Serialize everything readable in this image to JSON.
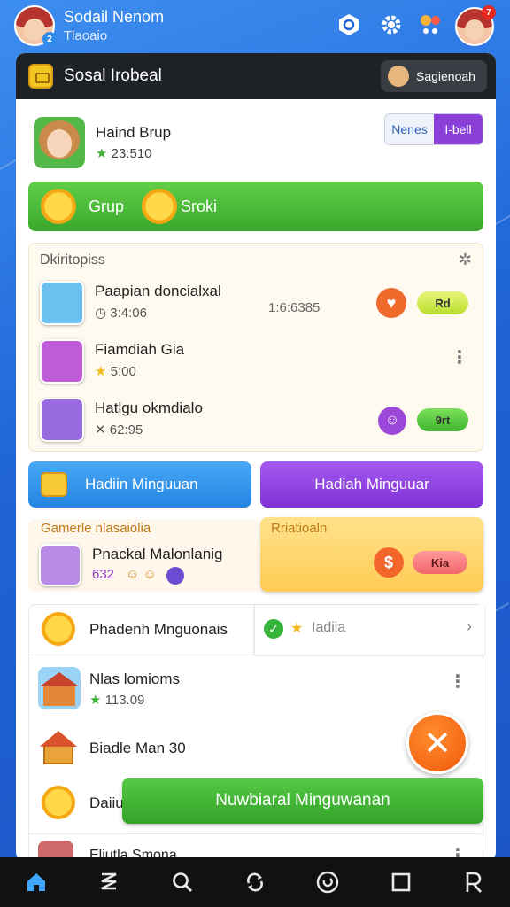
{
  "header": {
    "user_name": "Sodail Nenom",
    "user_sub": "Tlaoaio",
    "avatar_badge": "2",
    "notif_badge": "7"
  },
  "panel": {
    "title": "Sosal Irobeal",
    "title_button": "Sagienoah"
  },
  "group": {
    "name": "Haind Brup",
    "points": "23:510",
    "seg_left": "Nenes",
    "seg_right": "I-bell",
    "bar_left": "Grup",
    "bar_right": "Sroki"
  },
  "section": {
    "title": "Dkiritopiss",
    "rows": [
      {
        "name": "Paapian doncialxal",
        "sub": "3:4:06",
        "mid": "1:6:6385",
        "pill": "Rd"
      },
      {
        "name": "Fiamdiah Gia",
        "sub": "5:00"
      },
      {
        "name": "Hatlgu okmdialo",
        "sub": "62:95",
        "pill": "9rt"
      }
    ]
  },
  "buttons": {
    "left": "Hadiin Minguuan",
    "right": "Hadiah Minguuar"
  },
  "promo": {
    "left_title": "Gamerle nlasaiolia",
    "left_name": "Pnackal Malonlanig",
    "left_score": "632",
    "right_title": "Rriatioaln",
    "right_pill": "Kia"
  },
  "list": {
    "item1": "Phadenh Mnguonais",
    "item1_right": "Iadiia",
    "item2_name": "Nlas lomioms",
    "item2_pts": "113.09",
    "item3": "Biadle Man 30",
    "item4": "Daiiu",
    "item5": "Eliutla Smona",
    "cta": "Nuwbiaral Minguwanan"
  },
  "colors": {
    "accent_green": "#3aa72d",
    "accent_purple": "#8b3fd8",
    "accent_blue": "#2f8ce6",
    "accent_orange": "#f05a0c"
  }
}
